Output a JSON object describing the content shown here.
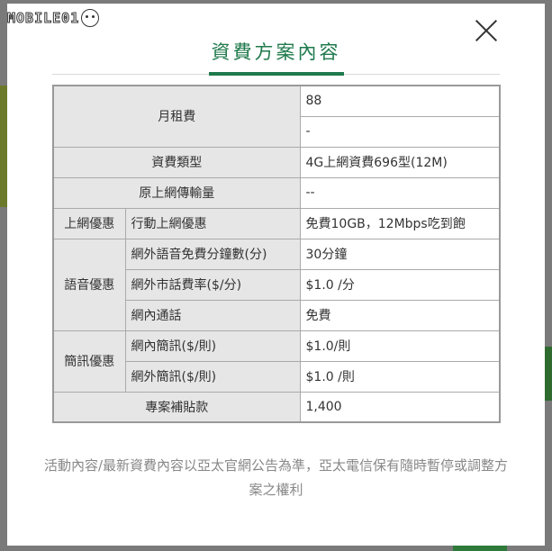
{
  "logo": {
    "text": "MOBILE01"
  },
  "modal": {
    "title": "資費方案內容",
    "close_label": "×"
  },
  "table": {
    "monthly_fee": {
      "label": "月租費",
      "value": "88",
      "value2": "-"
    },
    "plan_type": {
      "label": "資費類型",
      "value": "4G上網資費696型(12M)"
    },
    "original_data": {
      "label": "原上網傳輸量",
      "value": "--"
    },
    "internet": {
      "group": "上網優惠",
      "label": "行動上網優惠",
      "value": "免費10GB，12Mbps吃到飽"
    },
    "voice": {
      "group": "語音優惠",
      "rows": [
        {
          "label": "網外語音免費分鐘數(分)",
          "value": "30分鐘"
        },
        {
          "label": "網外市話費率($/分)",
          "value": "$1.0 /分"
        },
        {
          "label": "網內通話",
          "value": "免費"
        }
      ]
    },
    "sms": {
      "group": "簡訊優惠",
      "rows": [
        {
          "label": "網內簡訊($/則)",
          "value": "$1.0/則"
        },
        {
          "label": "網外簡訊($/則)",
          "value": "$1.0 /則"
        }
      ]
    },
    "subsidy": {
      "label": "專案補貼款",
      "value": "1,400"
    }
  },
  "note": "活動內容/最新資費內容以亞太官網公告為準，亞太電信保有隨時暫停或調整方案之權利"
}
